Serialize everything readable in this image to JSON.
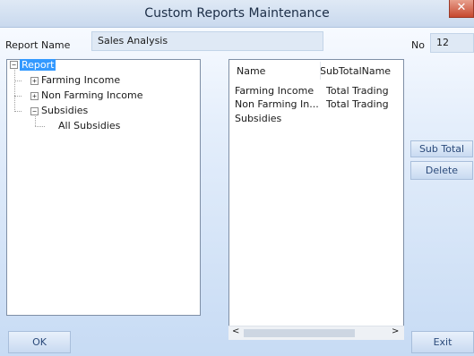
{
  "window": {
    "title": "Custom Reports Maintenance",
    "close_glyph": "✕"
  },
  "form": {
    "report_name_label": "Report Name",
    "report_name_value": "Sales Analysis",
    "no_label": "No",
    "no_value": "12"
  },
  "tree": {
    "root": "Report",
    "items": [
      {
        "label": "Farming Income",
        "expander": "+"
      },
      {
        "label": "Non Farming Income",
        "expander": "+"
      },
      {
        "label": "Subsidies",
        "expander": "−"
      }
    ],
    "subitems": [
      {
        "label": "All Subsidies"
      }
    ]
  },
  "list": {
    "columns": [
      "Name",
      "SubTotalName"
    ],
    "rows": [
      [
        "Farming Income",
        "Total Trading"
      ],
      [
        "Non Farming In...",
        "Total Trading"
      ],
      [
        "Subsidies",
        ""
      ]
    ],
    "scroll_left": "<",
    "scroll_right": ">"
  },
  "buttons": {
    "sub_total": "Sub Total",
    "delete": "Delete",
    "ok": "OK",
    "exit": "Exit"
  }
}
